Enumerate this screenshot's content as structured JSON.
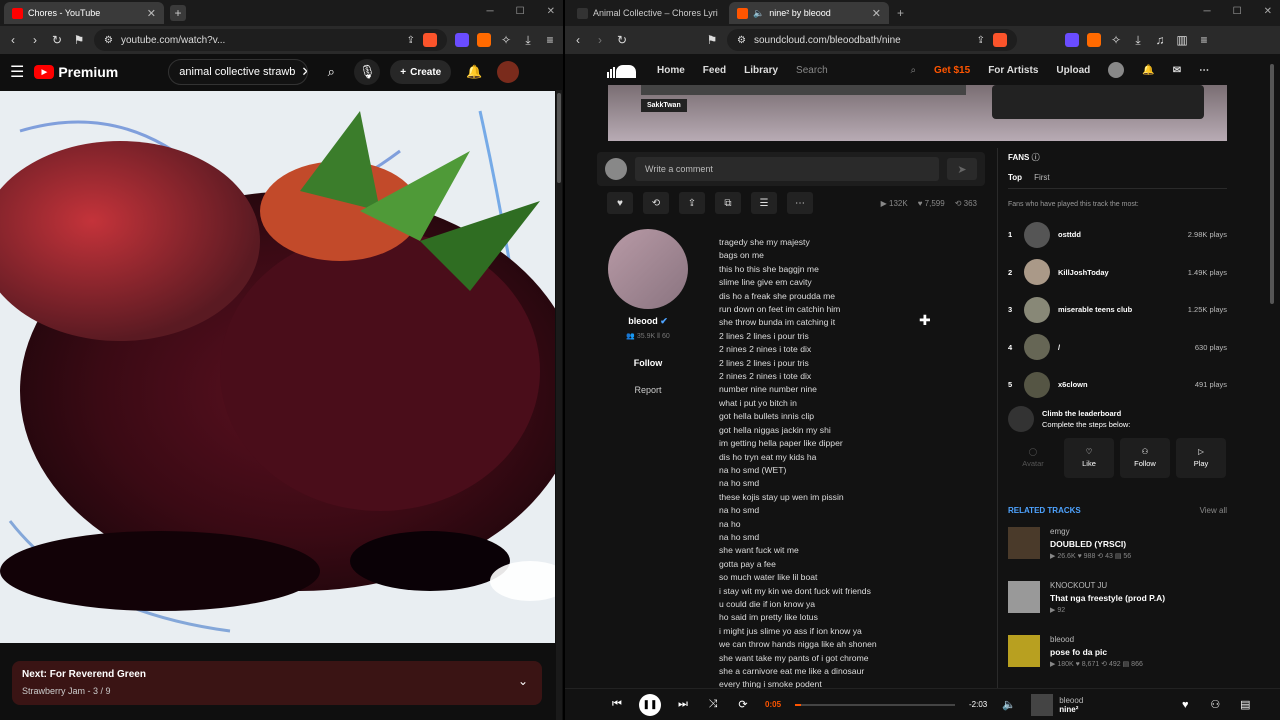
{
  "left": {
    "tab_title": "Chores - YouTube",
    "url": "youtube.com/watch?v...",
    "yt_brand": "Premium",
    "search_value": "animal collective strawb",
    "create_label": "Create",
    "next_label": "Next: For Reverend Green",
    "next_sub": "Strawberry Jam - 3 / 9"
  },
  "right": {
    "tab1_title": "Animal Collective – Chores Lyrics | Ge",
    "tab2_title": "nine² by bleood",
    "url": "soundcloud.com/bleoodbath/nine",
    "nav": [
      "Home",
      "Feed",
      "Library"
    ],
    "search_placeholder": "Search",
    "get15": "Get $15",
    "for_artists": "For Artists",
    "upload": "Upload",
    "banner_tag": "SakkTwan",
    "comment_placeholder": "Write a comment",
    "stats": {
      "plays": "132K",
      "likes": "7,599",
      "reposts": "363"
    },
    "artist": {
      "name": "bleood",
      "followers": "35.9K",
      "tracks": "60",
      "follow": "Follow",
      "report": "Report"
    },
    "lyrics": [
      "tragedy she my majesty",
      "bags on me",
      "this ho this she baggjn me",
      "slime line give em cavity",
      "dis ho a freak she proudda me",
      "run down on feet im catchin him",
      "she throw bunda im catching it",
      "2 lines 2 lines i pour tris",
      "2 nines 2 nines i tote dix",
      "2 lines 2 lines i pour tris",
      "2 nines 2 nines i tote dix",
      "number nine number nine",
      "what i put yo bitch in",
      "got hella bullets innis clip",
      "got hella niggas jackin my shi",
      "im getting hella paper like dipper",
      "dis ho tryn eat my kids ha",
      "na ho smd (WET)",
      "na ho smd",
      "these kojis stay up wen im pissin",
      "na ho smd",
      "na ho",
      "na ho smd",
      "she want fuck wit me",
      "gotta pay a fee",
      "so much water like lil boat",
      "i stay wit my kin we dont fuck wit friends",
      "u could die if ion know ya",
      "ho said im pretty like lotus",
      "i might jus slime yo ass if ion know ya",
      "we can throw hands nigga like ah shonen",
      "she want take my pants of i got chrome",
      "she a carnivore eat me like a dinosaur",
      "every thing i smoke podent"
    ],
    "fans": {
      "title": "FANS",
      "tab_top": "Top",
      "tab_first": "First",
      "subtitle": "Fans who have played this track the most:",
      "list": [
        {
          "rank": "1",
          "name": "osttdd",
          "plays": "2.98K plays"
        },
        {
          "rank": "2",
          "name": "KillJoshToday",
          "plays": "1.49K plays"
        },
        {
          "rank": "3",
          "name": "miserable teens club",
          "plays": "1.25K plays"
        },
        {
          "rank": "4",
          "name": "/",
          "plays": "630 plays"
        },
        {
          "rank": "5",
          "name": "x6clown",
          "plays": "491 plays"
        }
      ],
      "climb_title": "Climb the leaderboard",
      "climb_sub": "Complete the steps below:",
      "steps": [
        "Avatar",
        "Like",
        "Follow",
        "Play"
      ]
    },
    "related": {
      "title": "RELATED TRACKS",
      "view_all": "View all",
      "tracks": [
        {
          "artist": "emgy",
          "title": "DOUBLED (YRSCI)",
          "stats": "▶ 26.6K ♥ 988 ⟲ 43 ▤ 56"
        },
        {
          "artist": "KNOCKOUT JU",
          "title": "That nga freestyle (prod P.A)",
          "stats": "▶ 92"
        },
        {
          "artist": "bleood",
          "title": "pose fo da pic",
          "stats": "▶ 180K ♥ 8,671 ⟲ 492 ▤ 866"
        }
      ]
    },
    "player": {
      "elapsed": "0:05",
      "remaining": "-2:03",
      "artist": "bleood",
      "title": "nine²",
      "progress": 0.04
    }
  }
}
